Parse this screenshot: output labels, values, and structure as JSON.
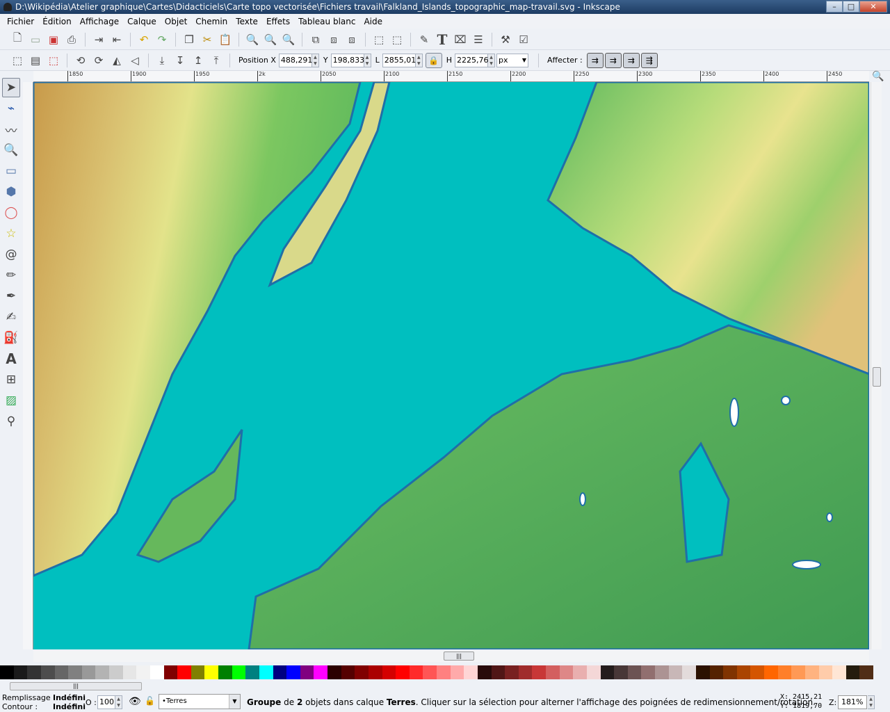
{
  "window": {
    "title": "D:\\Wikipédia\\Atelier graphique\\Cartes\\Didacticiels\\Carte topo vectorisée\\Fichiers travail\\Falkland_Islands_topographic_map-travail.svg - Inkscape",
    "buttons": [
      "minimize",
      "maximize",
      "close"
    ]
  },
  "menu": [
    "Fichier",
    "Édition",
    "Affichage",
    "Calque",
    "Objet",
    "Chemin",
    "Texte",
    "Effets",
    "Tableau blanc",
    "Aide"
  ],
  "commands_toolbar": [
    "new-icon",
    "open-icon",
    "save-icon",
    "print-icon",
    "import-icon",
    "export-icon",
    "undo-icon",
    "redo-icon",
    "copy-icon",
    "cut-icon",
    "paste-icon",
    "zoom-selection-icon",
    "zoom-drawing-icon",
    "zoom-page-icon",
    "duplicate-icon",
    "clone-icon",
    "unlink-clone-icon",
    "group-icon",
    "ungroup-icon",
    "fill-stroke-icon",
    "text-icon",
    "xml-editor-icon",
    "align-icon",
    "preferences-icon",
    "document-properties-icon"
  ],
  "select_toolbar": {
    "x_label": "Position X",
    "x": "488,291",
    "y_label": "Y",
    "y": "198,833",
    "w_label": "L",
    "w": "2855,01",
    "h_label": "H",
    "h": "2225,76",
    "unit": "px",
    "affect_label": "Affecter :"
  },
  "ruler": {
    "h_ticks": [
      "1850",
      "1900",
      "1950",
      "2k",
      "2050",
      "2100",
      "2150",
      "2200",
      "2250",
      "2300",
      "2350",
      "2400",
      "2450"
    ]
  },
  "tools": [
    "selector",
    "node",
    "tweak",
    "zoom",
    "rectangle",
    "3d-box",
    "ellipse",
    "star",
    "spiral",
    "pencil",
    "pen",
    "calligraphy",
    "paint-bucket",
    "text",
    "connector",
    "gradient",
    "dropper"
  ],
  "palette": [
    "#000000",
    "#1a1a1a",
    "#333333",
    "#4d4d4d",
    "#666666",
    "#808080",
    "#999999",
    "#b3b3b3",
    "#cccccc",
    "#e6e6e6",
    "#f2f2f2",
    "#ffffff",
    "#800000",
    "#ff0000",
    "#808000",
    "#ffff00",
    "#008000",
    "#00ff00",
    "#008080",
    "#00ffff",
    "#000080",
    "#0000ff",
    "#800080",
    "#ff00ff",
    "#2b0000",
    "#550000",
    "#800000",
    "#aa0000",
    "#d40000",
    "#ff0000",
    "#ff2a2a",
    "#ff5555",
    "#ff8080",
    "#ffaaaa",
    "#ffd5d5",
    "#280b0b",
    "#501616",
    "#782121",
    "#a02c2c",
    "#c83737",
    "#d35f5f",
    "#de8787",
    "#e9afaf",
    "#f4d7d7",
    "#241c1c",
    "#483737",
    "#6c5353",
    "#916f6f",
    "#ac9393",
    "#c8b7b7",
    "#e3dbdb",
    "#2b1100",
    "#552200",
    "#803300",
    "#aa4400",
    "#d45500",
    "#ff6600",
    "#ff7f2a",
    "#ff9955",
    "#ffb380",
    "#ffccaa",
    "#ffe6d5",
    "#241c0e",
    "#502d16"
  ],
  "status": {
    "fill_label": "Remplissage :",
    "fill_value": "Indéfini",
    "stroke_label": "Contour :",
    "stroke_value": "Indéfini",
    "opacity_label": "O :",
    "opacity": "100",
    "layer": "•Terres",
    "msg_b1": "Groupe",
    "msg_t1": " de ",
    "msg_b2": "2",
    "msg_t2": " objets dans calque ",
    "msg_b3": "Terres",
    "msg_t3": ". Cliquer sur la sélection pour alterner l'affichage des poignées de redimensionnement/rotation.",
    "cursor_x": "X: 2415,21",
    "cursor_y": "Y: 1819,70",
    "zoom_label": "Z:",
    "zoom": "181%"
  },
  "colors": {
    "water": "#00bfbf",
    "coast": "#1f6fa8",
    "land_low": "#5cb85c",
    "land_mid": "#e3e38a",
    "land_high": "#c89a4a"
  }
}
